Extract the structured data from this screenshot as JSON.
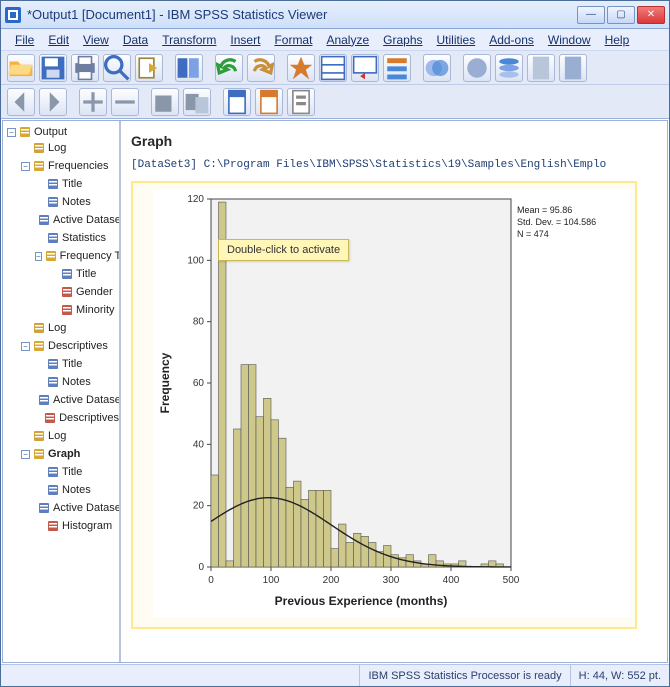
{
  "window": {
    "title": "*Output1 [Document1] - IBM SPSS Statistics Viewer",
    "min": "—",
    "max": "▢",
    "close": "✕"
  },
  "menu": {
    "items": [
      "File",
      "Edit",
      "View",
      "Data",
      "Transform",
      "Insert",
      "Format",
      "Analyze",
      "Graphs",
      "Utilities",
      "Add-ons",
      "Window",
      "Help"
    ]
  },
  "outline": {
    "root": "Output",
    "root_open": "−",
    "children": [
      {
        "label": "Log",
        "icon": "log"
      },
      {
        "label": "Frequencies",
        "icon": "folder",
        "open": "−",
        "children": [
          {
            "label": "Title",
            "icon": "title"
          },
          {
            "label": "Notes",
            "icon": "notes"
          },
          {
            "label": "Active Dataset",
            "icon": "active"
          },
          {
            "label": "Statistics",
            "icon": "stats"
          },
          {
            "label": "Frequency Table",
            "icon": "folder",
            "open": "−",
            "children": [
              {
                "label": "Title",
                "icon": "title"
              },
              {
                "label": "Gender",
                "icon": "table"
              },
              {
                "label": "Minority",
                "icon": "table"
              }
            ]
          }
        ]
      },
      {
        "label": "Log",
        "icon": "log"
      },
      {
        "label": "Descriptives",
        "icon": "folder",
        "open": "−",
        "children": [
          {
            "label": "Title",
            "icon": "title"
          },
          {
            "label": "Notes",
            "icon": "notes"
          },
          {
            "label": "Active Dataset",
            "icon": "active"
          },
          {
            "label": "Descriptives",
            "icon": "table"
          }
        ]
      },
      {
        "label": "Log",
        "icon": "log"
      },
      {
        "label": "Graph",
        "icon": "folder",
        "open": "−",
        "selected": true,
        "children": [
          {
            "label": "Title",
            "icon": "title"
          },
          {
            "label": "Notes",
            "icon": "notes"
          },
          {
            "label": "Active Dataset",
            "icon": "active"
          },
          {
            "label": "Histogram",
            "icon": "hist"
          }
        ]
      }
    ]
  },
  "content": {
    "heading": "Graph",
    "dataset_line": "[DataSet3] C:\\Program Files\\IBM\\SPSS\\Statistics\\19\\Samples\\English\\Emplo",
    "tooltip": "Double-click to activate",
    "stats": {
      "mean": "Mean = 95.86",
      "sd": "Std. Dev. = 104.586",
      "n": "N = 474"
    }
  },
  "status": {
    "processor": "IBM SPSS Statistics Processor is ready",
    "dims": "H: 44, W: 552 pt."
  },
  "chart_data": {
    "type": "bar",
    "title": "",
    "xlabel": "Previous Experience (months)",
    "ylabel": "Frequency",
    "xlim": [
      0,
      500
    ],
    "ylim": [
      0,
      120
    ],
    "xticks": [
      0,
      100,
      200,
      300,
      400,
      500
    ],
    "yticks": [
      0,
      20,
      40,
      60,
      80,
      100,
      120
    ],
    "bin_width": 12.5,
    "categories": [
      6.25,
      18.75,
      31.25,
      43.75,
      56.25,
      68.75,
      81.25,
      93.75,
      106.25,
      118.75,
      131.25,
      143.75,
      156.25,
      168.75,
      181.25,
      193.75,
      206.25,
      218.75,
      231.25,
      243.75,
      256.25,
      268.75,
      281.25,
      293.75,
      306.25,
      318.75,
      331.25,
      343.75,
      356.25,
      368.75,
      381.25,
      393.75,
      406.25,
      418.75,
      431.25,
      443.75,
      456.25,
      468.75,
      481.25
    ],
    "values": [
      30,
      119,
      2,
      45,
      66,
      66,
      49,
      55,
      48,
      42,
      26,
      28,
      22,
      25,
      25,
      25,
      6,
      14,
      8,
      11,
      10,
      8,
      5,
      7,
      4,
      3,
      4,
      2,
      1,
      4,
      2,
      1,
      1,
      2,
      0,
      0,
      1,
      2,
      1
    ],
    "overlay_curve": {
      "type": "normal",
      "mean": 95.86,
      "sd": 104.586,
      "n": 474
    },
    "annotations": [
      "Mean = 95.86",
      "Std. Dev. = 104.586",
      "N = 474"
    ],
    "bar_color": "#cec98a"
  }
}
